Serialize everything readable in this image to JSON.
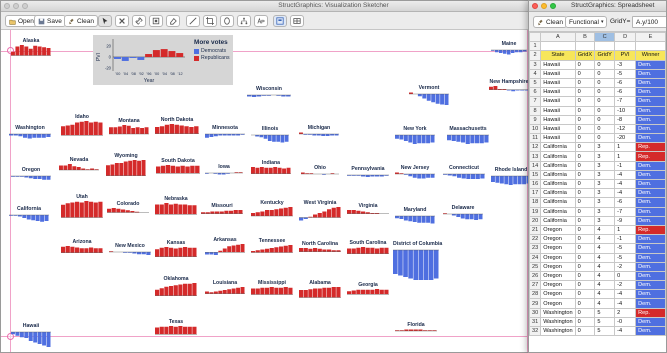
{
  "sketcher": {
    "title": "StructGraphics: Visualization Sketcher",
    "toolbar": {
      "open_label": "Open",
      "save_label": "Save",
      "clean_label": "Clean"
    },
    "legend": {
      "y_axis_label": "PVI",
      "x_axis_label": "Year",
      "y_ticks": [
        "20",
        "0",
        "-20"
      ],
      "x_ticks": [
        "'00",
        "'04",
        "'08",
        "'92",
        "'96",
        "'00",
        "'04",
        "'08",
        "'12"
      ],
      "title": "More votes",
      "items": [
        {
          "label": "Democrats",
          "color": "#4f6fe0"
        },
        {
          "label": "Republicans",
          "color": "#d42a2a"
        }
      ],
      "values": [
        -2,
        -4,
        -1,
        -3,
        3,
        7,
        8,
        6,
        4
      ]
    },
    "states": [
      {
        "name": "Alaska",
        "values": [
          5,
          12,
          14,
          12,
          9,
          13,
          12,
          11,
          10
        ]
      },
      {
        "name": "Maine",
        "values": [
          -1,
          -3,
          -4,
          -5,
          -6,
          -4,
          -3,
          -3,
          -2
        ]
      },
      {
        "name": "Vermont",
        "values": [
          2,
          0,
          -3,
          -6,
          -9,
          -11,
          -13,
          -14,
          -15
        ]
      },
      {
        "name": "New Hampshire",
        "values": [
          4,
          5,
          1,
          1,
          -1,
          -2,
          -1,
          -1,
          -1
        ]
      },
      {
        "name": "Wisconsin",
        "values": [
          -2,
          -3,
          -2,
          -1,
          -1,
          0,
          -1,
          -2,
          -2
        ]
      },
      {
        "name": "Washington",
        "values": [
          -2,
          -2,
          -3,
          -5,
          -6,
          -5,
          -5,
          -5,
          -4
        ]
      },
      {
        "name": "Idaho",
        "values": [
          12,
          13,
          14,
          17,
          18,
          19,
          17,
          18,
          17
        ]
      },
      {
        "name": "Montana",
        "values": [
          9,
          9,
          10,
          12,
          11,
          8,
          9,
          8,
          9
        ]
      },
      {
        "name": "North Dakota",
        "values": [
          9,
          10,
          12,
          13,
          12,
          11,
          10,
          9,
          10
        ]
      },
      {
        "name": "Minnesota",
        "values": [
          -5,
          -4,
          -3,
          -2,
          -2,
          -2,
          -2,
          -2,
          -1
        ]
      },
      {
        "name": "Illinois",
        "values": [
          0,
          -2,
          -3,
          -5,
          -8,
          -9,
          -9,
          -10,
          -9
        ]
      },
      {
        "name": "Michigan",
        "values": [
          2,
          -1,
          -1,
          -2,
          -2,
          -3,
          -3,
          -2,
          -2
        ]
      },
      {
        "name": "New York",
        "values": [
          -5,
          -6,
          -8,
          -10,
          -12,
          -11,
          -11,
          -11,
          -10
        ]
      },
      {
        "name": "Massachusetts",
        "values": [
          -7,
          -8,
          -9,
          -10,
          -12,
          -11,
          -11,
          -11,
          -10
        ]
      },
      {
        "name": "Oregon",
        "values": [
          -1,
          -1,
          -1,
          -2,
          -3,
          -4,
          -4,
          -5,
          -5
        ]
      },
      {
        "name": "Nevada",
        "values": [
          6,
          6,
          8,
          5,
          4,
          2,
          1,
          2,
          1
        ]
      },
      {
        "name": "Wyoming",
        "values": [
          14,
          15,
          17,
          17,
          19,
          20,
          21,
          20,
          21
        ]
      },
      {
        "name": "South Dakota",
        "values": [
          9,
          10,
          11,
          10,
          9,
          10,
          9,
          10,
          10
        ]
      },
      {
        "name": "Iowa",
        "values": [
          -1,
          0,
          -1,
          -2,
          -2,
          -1,
          0,
          1,
          1
        ]
      },
      {
        "name": "Indiana",
        "values": [
          9,
          8,
          9,
          8,
          8,
          9,
          8,
          7,
          8
        ]
      },
      {
        "name": "Ohio",
        "values": [
          2,
          1,
          1,
          0,
          0,
          -1,
          0,
          1,
          0
        ]
      },
      {
        "name": "Pennsylvania",
        "values": [
          -1,
          -1,
          -1,
          -2,
          -3,
          -2,
          -2,
          -2,
          -1
        ]
      },
      {
        "name": "New Jersey",
        "values": [
          2,
          1,
          -1,
          -3,
          -5,
          -6,
          -6,
          -5,
          -5
        ]
      },
      {
        "name": "Connecticut",
        "values": [
          -1,
          -2,
          -3,
          -5,
          -6,
          -7,
          -7,
          -7,
          -6
        ]
      },
      {
        "name": "Rhode Island",
        "values": [
          -8,
          -9,
          -10,
          -11,
          -12,
          -11,
          -11,
          -11,
          -10
        ]
      },
      {
        "name": "California",
        "values": [
          -1,
          -1,
          -2,
          -4,
          -6,
          -7,
          -8,
          -9,
          -8
        ]
      },
      {
        "name": "Utah",
        "values": [
          17,
          19,
          20,
          21,
          20,
          22,
          21,
          20,
          21
        ]
      },
      {
        "name": "Colorado",
        "values": [
          5,
          6,
          5,
          4,
          3,
          2,
          1,
          0,
          0
        ]
      },
      {
        "name": "Nebraska",
        "values": [
          13,
          13,
          15,
          13,
          14,
          13,
          13,
          12,
          12
        ]
      },
      {
        "name": "Missouri",
        "values": [
          2,
          2,
          3,
          3,
          3,
          4,
          4,
          5,
          5
        ]
      },
      {
        "name": "Kentucky",
        "values": [
          4,
          5,
          6,
          8,
          8,
          9,
          10,
          11,
          12
        ]
      },
      {
        "name": "West Virginia",
        "values": [
          -4,
          -2,
          1,
          4,
          6,
          8,
          11,
          13,
          14
        ]
      },
      {
        "name": "Virginia",
        "values": [
          5,
          5,
          4,
          3,
          2,
          1,
          1,
          0,
          0
        ]
      },
      {
        "name": "Maryland",
        "values": [
          -3,
          -4,
          -6,
          -7,
          -8,
          -9,
          -9,
          -9,
          -10
        ]
      },
      {
        "name": "Delaware",
        "values": [
          1,
          0,
          -2,
          -4,
          -6,
          -7,
          -7,
          -8,
          -7
        ]
      },
      {
        "name": "Arizona",
        "values": [
          8,
          9,
          8,
          7,
          6,
          6,
          7,
          6,
          6
        ]
      },
      {
        "name": "New Mexico",
        "values": [
          1,
          0,
          0,
          -1,
          -1,
          -2,
          -3,
          -3,
          -4
        ]
      },
      {
        "name": "Kansas",
        "values": [
          10,
          12,
          13,
          12,
          11,
          12,
          13,
          12,
          12
        ]
      },
      {
        "name": "Arkansas",
        "values": [
          -3,
          -3,
          -4,
          2,
          5,
          8,
          9,
          10,
          11
        ]
      },
      {
        "name": "Tennessee",
        "values": [
          2,
          3,
          4,
          5,
          6,
          7,
          8,
          9,
          10
        ]
      },
      {
        "name": "North Carolina",
        "values": [
          5,
          5,
          4,
          5,
          4,
          3,
          3,
          2,
          2
        ]
      },
      {
        "name": "South Carolina",
        "values": [
          7,
          7,
          8,
          9,
          8,
          8,
          7,
          8,
          8
        ]
      },
      {
        "name": "District of Columbia",
        "values": [
          -32,
          -34,
          -36,
          -38,
          -40,
          -40,
          -40,
          -40,
          -38
        ]
      },
      {
        "name": "Oklahoma",
        "values": [
          8,
          10,
          12,
          13,
          14,
          15,
          16,
          16,
          17
        ]
      },
      {
        "name": "Louisiana",
        "values": [
          3,
          2,
          3,
          4,
          5,
          6,
          7,
          8,
          9
        ]
      },
      {
        "name": "Mississippi",
        "values": [
          8,
          8,
          9,
          9,
          10,
          9,
          9,
          10,
          9
        ]
      },
      {
        "name": "Alabama",
        "values": [
          10,
          10,
          11,
          12,
          12,
          13,
          13,
          14,
          14
        ]
      },
      {
        "name": "Georgia",
        "values": [
          4,
          5,
          6,
          6,
          6,
          6,
          7,
          6,
          6
        ]
      },
      {
        "name": "Texas",
        "values": [
          9,
          10,
          10,
          11,
          10,
          11,
          10,
          10,
          10
        ]
      },
      {
        "name": "Florida",
        "values": [
          1,
          1,
          2,
          2,
          2,
          2,
          1,
          1,
          1
        ]
      },
      {
        "name": "Hawaii",
        "values": [
          -3,
          -5,
          -7,
          -8,
          -12,
          -14,
          -16,
          -18,
          -20
        ]
      }
    ]
  },
  "spreadsheet": {
    "title": "StructGraphics: Spreadsheet",
    "clean_label": "Clean",
    "mode_value": "Functional",
    "formula_label": "GridY=",
    "formula_value": "A.y/100",
    "columns": [
      "",
      "A",
      "B",
      "C",
      "D",
      "E"
    ],
    "header_row": [
      "State",
      "GridX",
      "GridY",
      "PVI",
      "Winner"
    ],
    "rows": [
      [
        "Hawaii",
        "0",
        "0",
        "-3",
        "Dem."
      ],
      [
        "Hawaii",
        "0",
        "0",
        "-5",
        "Dem."
      ],
      [
        "Hawaii",
        "0",
        "0",
        "-6",
        "Dem."
      ],
      [
        "Hawaii",
        "0",
        "0",
        "-6",
        "Dem."
      ],
      [
        "Hawaii",
        "0",
        "0",
        "-7",
        "Dem."
      ],
      [
        "Hawaii",
        "0",
        "0",
        "-10",
        "Dem."
      ],
      [
        "Hawaii",
        "0",
        "0",
        "-8",
        "Dem."
      ],
      [
        "Hawaii",
        "0",
        "0",
        "-12",
        "Dem."
      ],
      [
        "Hawaii",
        "0",
        "0",
        "-20",
        "Dem."
      ],
      [
        "California",
        "0",
        "3",
        "1",
        "Rep."
      ],
      [
        "California",
        "0",
        "3",
        "1",
        "Rep."
      ],
      [
        "California",
        "0",
        "3",
        "-1",
        "Dem."
      ],
      [
        "California",
        "0",
        "3",
        "-4",
        "Dem."
      ],
      [
        "California",
        "0",
        "3",
        "-4",
        "Dem."
      ],
      [
        "California",
        "0",
        "3",
        "-4",
        "Dem."
      ],
      [
        "California",
        "0",
        "3",
        "-6",
        "Dem."
      ],
      [
        "California",
        "0",
        "3",
        "-7",
        "Dem."
      ],
      [
        "California",
        "0",
        "3",
        "-9",
        "Dem."
      ],
      [
        "Oregon",
        "0",
        "4",
        "1",
        "Rep."
      ],
      [
        "Oregon",
        "0",
        "4",
        "-1",
        "Dem."
      ],
      [
        "Oregon",
        "0",
        "4",
        "-5",
        "Dem."
      ],
      [
        "Oregon",
        "0",
        "4",
        "-5",
        "Dem."
      ],
      [
        "Oregon",
        "0",
        "4",
        "-2",
        "Dem."
      ],
      [
        "Oregon",
        "0",
        "4",
        "0",
        "Dem."
      ],
      [
        "Oregon",
        "0",
        "4",
        "-2",
        "Dem."
      ],
      [
        "Oregon",
        "0",
        "4",
        "-4",
        "Dem."
      ],
      [
        "Oregon",
        "0",
        "4",
        "-4",
        "Dem."
      ],
      [
        "Washington",
        "0",
        "5",
        "2",
        "Rep."
      ],
      [
        "Washington",
        "0",
        "5",
        "-0",
        "Dem."
      ],
      [
        "Washington",
        "0",
        "5",
        "-4",
        "Dem."
      ]
    ]
  },
  "colors": {
    "dem": "#4f6fe0",
    "rep": "#d42a2a",
    "guide": "#f0a2c8",
    "legend_bg": "#d6d6d6",
    "header_yellow": "#f7e65a"
  }
}
